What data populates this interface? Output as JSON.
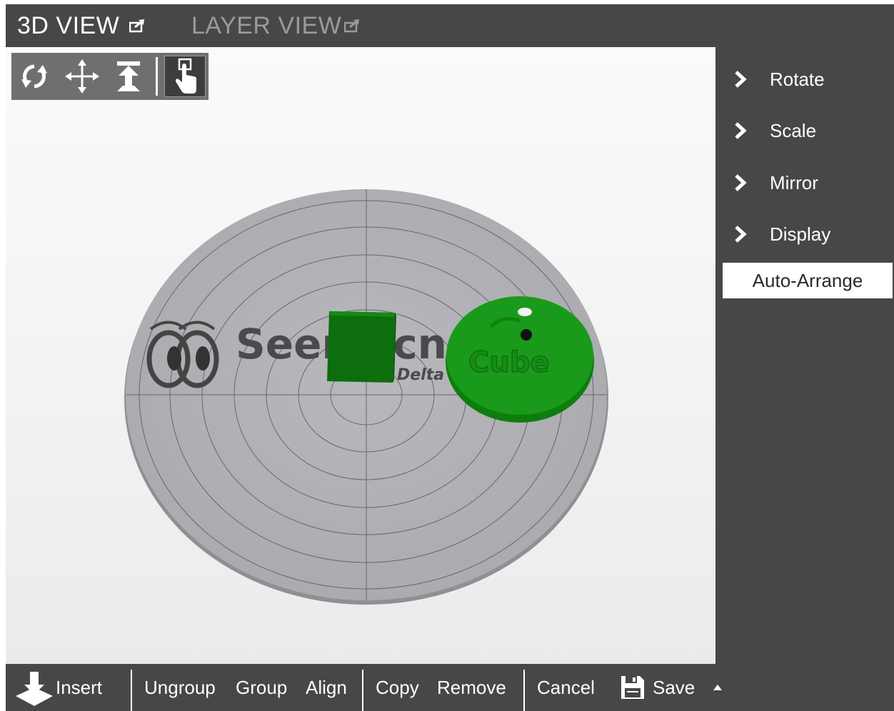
{
  "tabs": {
    "view3d": "3D VIEW",
    "layer": "LAYER VIEW"
  },
  "toolbox": {
    "tools": [
      "rotate-view-icon",
      "pan-icon",
      "lift-icon",
      "select-pointer-icon"
    ]
  },
  "scene": {
    "platform_logo_text": "Seemecnc",
    "platform_logo_subtext": "Delta",
    "object_text": "Cube",
    "colors": {
      "platform": "#b3b3b8",
      "object": "#1a9a1a",
      "object_dark": "#0c6e0c"
    }
  },
  "right_panel": {
    "items": [
      {
        "label": "Rotate",
        "icon": "chevron-right-icon"
      },
      {
        "label": "Scale",
        "icon": "chevron-right-icon"
      },
      {
        "label": "Mirror",
        "icon": "chevron-right-icon"
      },
      {
        "label": "Display",
        "icon": "chevron-right-icon"
      }
    ],
    "auto_arrange": "Auto-Arrange"
  },
  "bottom_bar": {
    "insert": "Insert",
    "ungroup": "Ungroup",
    "group": "Group",
    "align": "Align",
    "copy": "Copy",
    "remove": "Remove",
    "cancel": "Cancel",
    "save": "Save"
  },
  "colors": {
    "chrome": "#474747",
    "tab_active": "#ffffff",
    "tab_inactive": "#9a9a9a"
  }
}
